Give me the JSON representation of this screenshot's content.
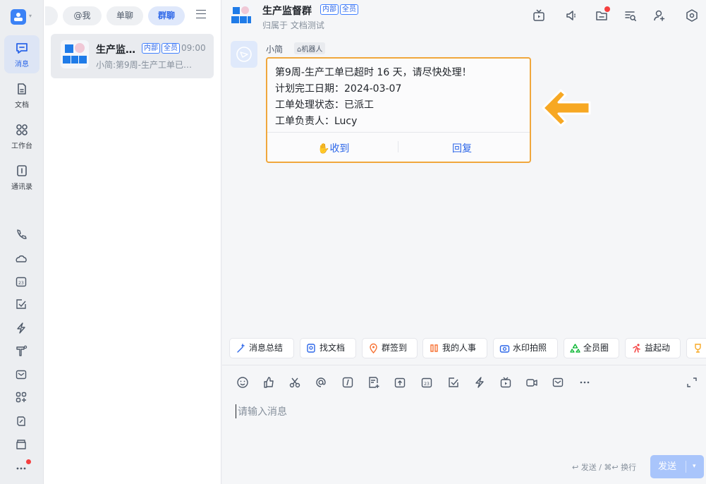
{
  "nav": {
    "items": [
      {
        "label": "消息",
        "icon": "message-icon"
      },
      {
        "label": "文档",
        "icon": "document-icon"
      },
      {
        "label": "工作台",
        "icon": "workbench-icon"
      },
      {
        "label": "通讯录",
        "icon": "contacts-icon"
      }
    ],
    "tools": [
      "phone-icon",
      "cloud-icon",
      "calendar-icon",
      "todo-icon",
      "bolt-icon",
      "meeting-icon",
      "mail-icon",
      "app-center-icon",
      "link-icon",
      "folder-icon",
      "more-icon"
    ]
  },
  "list": {
    "filters": [
      "@我",
      "单聊",
      "群聊"
    ],
    "active_filter": "群聊",
    "conversations": [
      {
        "title": "生产监…",
        "tag_internal": "内部",
        "tag_all": "全员",
        "time": "09:00",
        "preview": "小简:第9周-生产工单已…"
      }
    ]
  },
  "header": {
    "title": "生产监督群",
    "tag_internal": "内部",
    "tag_all": "全员",
    "subtitle": "归属于 文档测试"
  },
  "message": {
    "sender": "小简",
    "robot_tag": "机器人",
    "lines": [
      "第9周-生产工单已超时 16 天，请尽快处理！",
      "计划完工日期：2024-03-07",
      "工单处理状态：已派工",
      "工单负责人：Lucy"
    ],
    "ack_label": "收到",
    "reply_label": "回复"
  },
  "apps": [
    "消息总结",
    "找文档",
    "群签到",
    "我的人事",
    "水印拍照",
    "全员圈",
    "益起动"
  ],
  "composer": {
    "placeholder": "请输入消息",
    "hint": "↩ 发送 / ⌘↩ 换行",
    "send_label": "发送"
  },
  "colors": {
    "accent": "#2c66e8",
    "highlight": "#f0a73c",
    "notify": "#f53f3f"
  }
}
